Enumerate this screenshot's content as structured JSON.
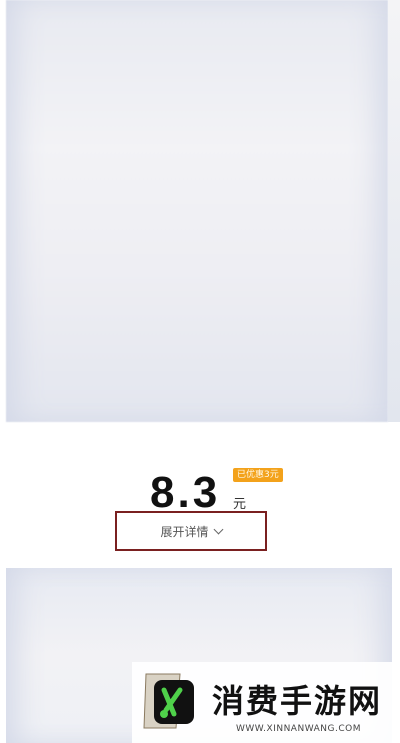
{
  "price": {
    "value": "8.3",
    "unit": "元",
    "discount_badge": "已优惠3元"
  },
  "details": {
    "expand_label": "展开详情"
  },
  "watermark": {
    "title": "消费手游网",
    "url": "WWW.XINNANWANG.COM"
  },
  "colors": {
    "badge": "#f3a21b",
    "highlight_border": "#7a2020"
  }
}
